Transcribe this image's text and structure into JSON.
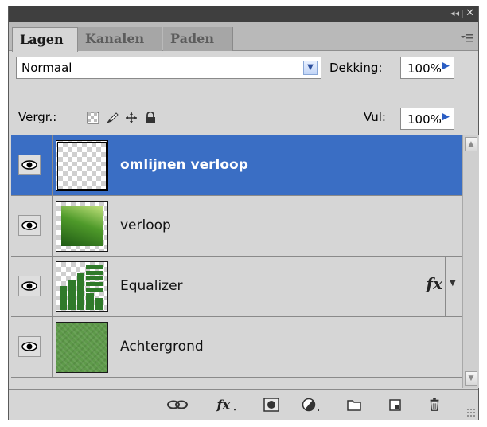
{
  "titlebar": {
    "collapse_glyph": "◂◂",
    "separator": "|",
    "close_glyph": "✕"
  },
  "tabs": [
    {
      "label": "Lagen",
      "active": true
    },
    {
      "label": "Kanalen",
      "active": false
    },
    {
      "label": "Paden",
      "active": false
    }
  ],
  "panel_menu_icon": "panel-menu-icon",
  "blend": {
    "value": "Normaal"
  },
  "opacity": {
    "label": "Dekking:",
    "value": "100%"
  },
  "lock": {
    "label": "Vergr.:"
  },
  "fill": {
    "label": "Vul:",
    "value": "100%"
  },
  "layers": [
    {
      "name": "omlijnen verloop",
      "selected": true,
      "visible": true,
      "fx": false
    },
    {
      "name": "verloop",
      "selected": false,
      "visible": true,
      "fx": false
    },
    {
      "name": "Equalizer",
      "selected": false,
      "visible": true,
      "fx": true,
      "fx_label": "fx"
    },
    {
      "name": "Achtergrond",
      "selected": false,
      "visible": true,
      "fx": false
    }
  ],
  "footer_icons": [
    "link-icon",
    "fx-icon",
    "mask-icon",
    "adjustment-icon",
    "folder-icon",
    "new-layer-icon",
    "trash-icon"
  ],
  "colors": {
    "selection": "#3a6ec4",
    "panel": "#d6d6d6",
    "titlebar": "#3f3f3f"
  }
}
